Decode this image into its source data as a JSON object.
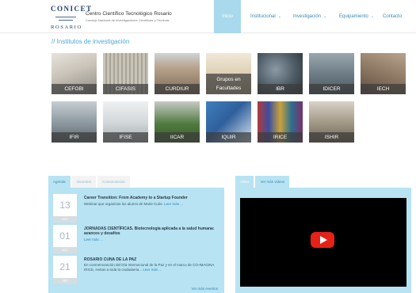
{
  "header": {
    "logo": {
      "top": "CONICET",
      "bottom": "ROSARIO"
    },
    "brand_title": "Centro Científico Tecnológico Rosario",
    "brand_subtitle": "Consejo Nacional de Investigaciones Científicas y Técnicas",
    "nav": [
      {
        "label": "Inicio",
        "active": true,
        "dropdown": false
      },
      {
        "label": "Institucional",
        "active": false,
        "dropdown": true
      },
      {
        "label": "Investigación",
        "active": false,
        "dropdown": true
      },
      {
        "label": "Equipamiento",
        "active": false,
        "dropdown": true
      },
      {
        "label": "Contacto",
        "active": false,
        "dropdown": false
      }
    ],
    "chevron": "⌄"
  },
  "section_title": "// Institutos de investigación",
  "institutes": [
    {
      "label": "CEFOBI"
    },
    {
      "label": "CIFASIS"
    },
    {
      "label": "CURDIUR"
    },
    {
      "label": "Grupos en Facultades"
    },
    {
      "label": "IBR"
    },
    {
      "label": "IDICER"
    },
    {
      "label": "IECH"
    },
    {
      "label": "IFIR"
    },
    {
      "label": "IFISE"
    },
    {
      "label": "IICAR"
    },
    {
      "label": "IQUIR"
    },
    {
      "label": "IRICE"
    },
    {
      "label": "ISHIR"
    }
  ],
  "agenda": {
    "tabs": [
      "Agenda",
      "Vacantes",
      "Convocatorias"
    ],
    "events": [
      {
        "day": "13",
        "month": "NOV",
        "title": "Career Transition: From Academy to a Startup Founder",
        "text": "Webinar que organizan los alumni de Marie Curie.",
        "more": "Leer más ..."
      },
      {
        "day": "01",
        "month": "NOV",
        "title": "JORNADAS CIENTÍFICAS. Biotecnología aplicada a la salud humana: avances y desafíos",
        "text": "",
        "more": "Leer más ..."
      },
      {
        "day": "21",
        "month": "SEP",
        "title": "ROSARIO CUNA DE LA PAZ",
        "text": "En conmemoración del Día Internacional de la Paz y en el marco de CO-IMAGINA IRICE, invitan a toda la ciudadanía...",
        "more": "Leer más ..."
      }
    ],
    "see_more": "Ver más eventos"
  },
  "video": {
    "tabs": [
      "Video",
      "Ver más videos"
    ],
    "play_icon": "youtube-play-icon"
  },
  "colors": {
    "accent": "#4fa9d8",
    "nav_active": "#a8d9ec",
    "panel": "#b7e3f3",
    "youtube": "#e62117"
  }
}
